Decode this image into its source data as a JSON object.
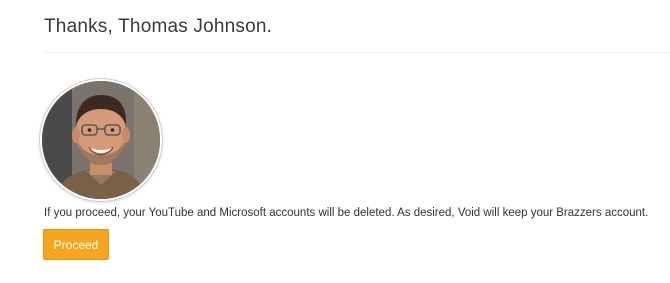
{
  "header": {
    "title": "Thanks, Thomas Johnson."
  },
  "profile": {
    "avatar_icon": "user-photo"
  },
  "message": {
    "text": "If you proceed, your YouTube and Microsoft accounts will be deleted. As desired, Void will keep your Brazzers account."
  },
  "actions": {
    "proceed_label": "Proceed",
    "proceed_color": "#f6a51f"
  }
}
